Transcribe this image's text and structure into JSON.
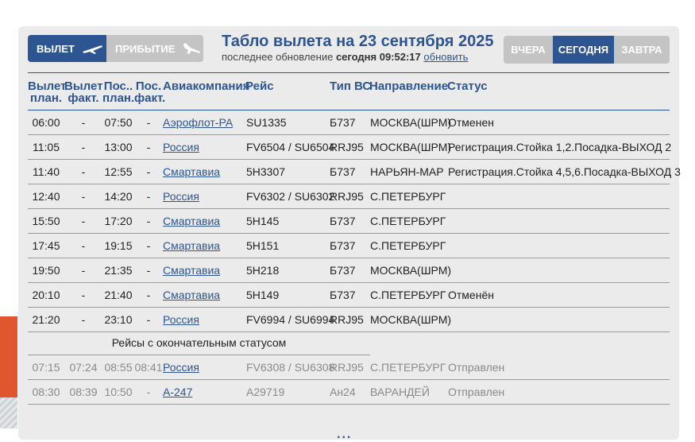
{
  "tabs": {
    "departure_label": "ВЫЛЕТ",
    "arrival_label": "ПРИБЫТИЕ",
    "active": "departure"
  },
  "board": {
    "title": "Табло вылета на 23 сентября 2025",
    "update_prefix": "последнее обновление",
    "update_value": "сегодня 09:52:17",
    "refresh_link": "обновить"
  },
  "days": {
    "yesterday": "ВЧЕРА",
    "today": "СЕГОДНЯ",
    "tomorrow": "ЗАВТРА",
    "active": "today"
  },
  "columns": {
    "dep_plan": [
      "Вылет",
      "план."
    ],
    "dep_fact": [
      "Вылет",
      "факт."
    ],
    "arr_plan": [
      "Пос..",
      "план."
    ],
    "arr_fact": [
      "Пос.",
      "факт."
    ],
    "airline": "Авиакомпания",
    "flight": "Рейс",
    "aircraft": "Тип ВС",
    "destination": "Направление",
    "status": "Статус"
  },
  "flights": [
    {
      "dep_plan": "06:00",
      "dep_fact": "-",
      "arr_plan": "07:50",
      "arr_fact": "-",
      "airline": "Аэрофлот-РА",
      "flight": "SU1335",
      "aircraft": "Б737",
      "destination": "МОСКВА(ШРМ)",
      "status": "Отменен"
    },
    {
      "dep_plan": "11:05",
      "dep_fact": "-",
      "arr_plan": "13:00",
      "arr_fact": "-",
      "airline": "Россия",
      "flight": "FV6504 / SU6504",
      "aircraft": "RRJ95",
      "destination": "МОСКВА(ШРМ)",
      "status": "Регистрация.Стойка 1,2.Посадка-ВЫХОД 2"
    },
    {
      "dep_plan": "11:40",
      "dep_fact": "-",
      "arr_plan": "12:55",
      "arr_fact": "-",
      "airline": "Смартавиа",
      "flight": "5H3307",
      "aircraft": "Б737",
      "destination": "НАРЬЯН-МАР",
      "status": "Регистрация.Стойка 4,5,6.Посадка-ВЫХОД 3"
    },
    {
      "dep_plan": "12:40",
      "dep_fact": "-",
      "arr_plan": "14:20",
      "arr_fact": "-",
      "airline": "Россия",
      "flight": "FV6302 / SU6302",
      "aircraft": "RRJ95",
      "destination": "С.ПЕТЕРБУРГ",
      "status": ""
    },
    {
      "dep_plan": "15:50",
      "dep_fact": "-",
      "arr_plan": "17:20",
      "arr_fact": "-",
      "airline": "Смартавиа",
      "flight": "5H145",
      "aircraft": "Б737",
      "destination": "С.ПЕТЕРБУРГ",
      "status": ""
    },
    {
      "dep_plan": "17:45",
      "dep_fact": "-",
      "arr_plan": "19:15",
      "arr_fact": "-",
      "airline": "Смартавиа",
      "flight": "5H151",
      "aircraft": "Б737",
      "destination": "С.ПЕТЕРБУРГ",
      "status": ""
    },
    {
      "dep_plan": "19:50",
      "dep_fact": "-",
      "arr_plan": "21:35",
      "arr_fact": "-",
      "airline": "Смартавиа",
      "flight": "5H218",
      "aircraft": "Б737",
      "destination": "МОСКВА(ШРМ)",
      "status": ""
    },
    {
      "dep_plan": "20:10",
      "dep_fact": "-",
      "arr_plan": "21:40",
      "arr_fact": "-",
      "airline": "Смартавиа",
      "flight": "5H149",
      "aircraft": "Б737",
      "destination": "С.ПЕТЕРБУРГ",
      "status": "Отменён"
    },
    {
      "dep_plan": "21:20",
      "dep_fact": "-",
      "arr_plan": "23:10",
      "arr_fact": "-",
      "airline": "Россия",
      "flight": "FV6994 / SU6994",
      "aircraft": "RRJ95",
      "destination": "МОСКВА(ШРМ)",
      "status": ""
    }
  ],
  "final_caption": "Рейсы с окончательным статусом",
  "final_flights": [
    {
      "dep_plan": "07:15",
      "dep_fact": "07:24",
      "arr_plan": "08:55",
      "arr_fact": "08:41",
      "airline": "Россия",
      "flight": "FV6308 / SU6308",
      "aircraft": "RRJ95",
      "destination": "С.ПЕТЕРБУРГ",
      "status": "Отправлен"
    },
    {
      "dep_plan": "08:30",
      "dep_fact": "08:39",
      "arr_plan": "10:50",
      "arr_fact": "-",
      "airline": "А-247",
      "flight": "A29719",
      "aircraft": "Ан24",
      "destination": "ВАРАНДЕЙ",
      "status": "Отправлен"
    }
  ],
  "more_indicator": "...",
  "colors": {
    "accent": "#2c5591",
    "inactive_button": "#c4c4c4",
    "panel_bg": "#ebebeb",
    "final_text": "#8a8a8a",
    "decor_orange": "#e0562e"
  }
}
